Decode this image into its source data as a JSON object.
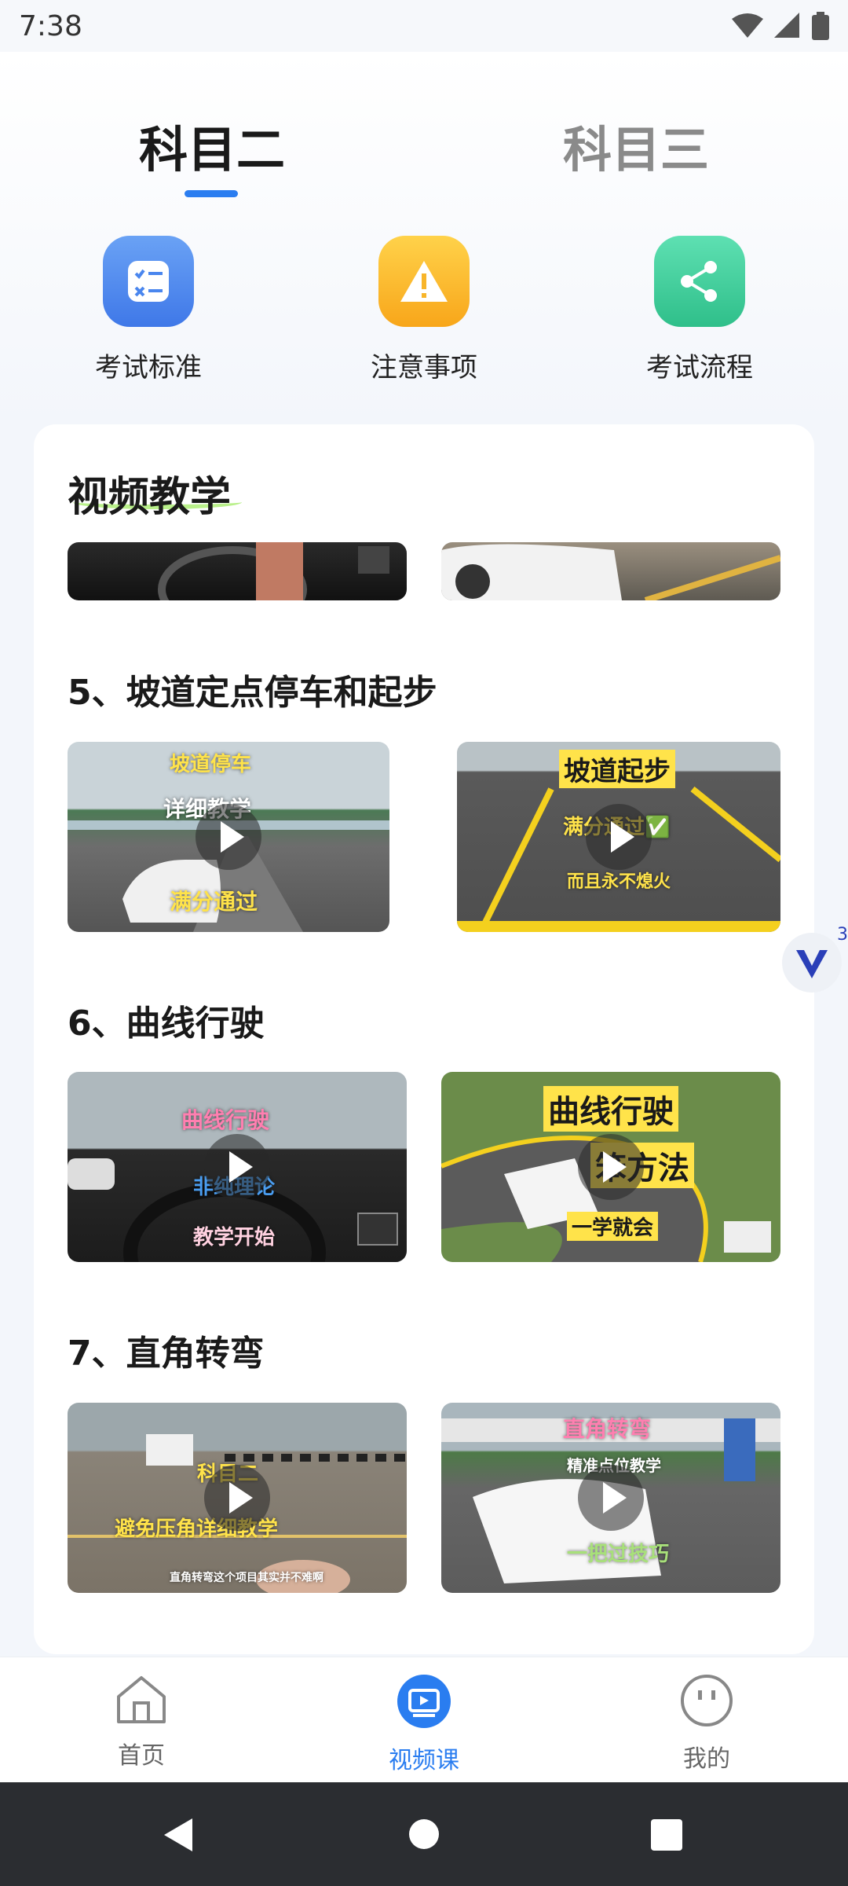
{
  "status_bar": {
    "time": "7:38"
  },
  "tabs": [
    {
      "label": "科目二",
      "active": true
    },
    {
      "label": "科目三",
      "active": false
    }
  ],
  "quick_actions": [
    {
      "label": "考试标准",
      "icon": "checklist-icon",
      "color": "#4a86ee"
    },
    {
      "label": "注意事项",
      "icon": "warning-icon",
      "color": "#f8b52a"
    },
    {
      "label": "考试流程",
      "icon": "share-icon",
      "color": "#3ecf9a"
    }
  ],
  "video_section": {
    "title": "视频教学",
    "groups": [
      {
        "title": "5、坡道定点停车和起步",
        "videos": [
          {
            "cap1": "坡道停车",
            "cap2": "详细教学",
            "cap3": "满分通过"
          },
          {
            "cap1": "坡道起步",
            "cap2": "满分通过✅",
            "cap3": "而且永不熄火"
          }
        ]
      },
      {
        "title": "6、曲线行驶",
        "videos": [
          {
            "cap1": "曲线行驶",
            "cap2": "非纯理论",
            "cap3": "教学开始"
          },
          {
            "cap1": "曲线行驶",
            "cap2": "笨方法",
            "cap3": "一学就会"
          }
        ]
      },
      {
        "title": "7、直角转弯",
        "videos": [
          {
            "cap1": "科目二",
            "cap2": "避免压角详细教学",
            "cap3": "直角转弯这个项目其实并不难啊"
          },
          {
            "cap1": "直角转弯",
            "cap2": "精准点位教学",
            "cap3": "一把过技巧"
          }
        ]
      }
    ]
  },
  "floating_badge": {
    "count": "3"
  },
  "bottom_nav": [
    {
      "label": "首页",
      "icon": "home-icon",
      "active": false
    },
    {
      "label": "视频课",
      "icon": "video-icon",
      "active": true
    },
    {
      "label": "我的",
      "icon": "smiley-icon",
      "active": false
    }
  ],
  "colors": {
    "accent": "#2a7df0",
    "caption_yellow": "#ffe34a",
    "caption_pink": "#ff7fb0"
  }
}
